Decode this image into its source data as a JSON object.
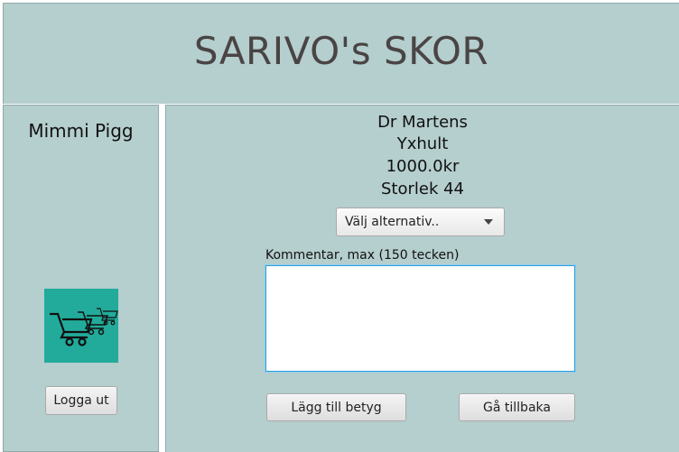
{
  "header": {
    "title": "SARIVO's SKOR"
  },
  "user": {
    "name": "Mimmi Pigg",
    "cart_icon": "shopping-cart-icon",
    "logout_label": "Logga ut"
  },
  "product": {
    "brand": "Dr Martens",
    "model": "Yxhult",
    "price": "1000.0kr",
    "size": "Storlek 44"
  },
  "rating_select": {
    "selected": "Välj alternativ.."
  },
  "comment": {
    "label": "Kommentar, max (150 tecken)",
    "value": ""
  },
  "actions": {
    "add_rating_label": "Lägg till betyg",
    "back_label": "Gå tillbaka"
  },
  "colors": {
    "panel_bg": "#b5cece",
    "cart_tile": "#22ab9b",
    "title_text": "#4a4444",
    "focus_border": "#2f9fd8"
  }
}
